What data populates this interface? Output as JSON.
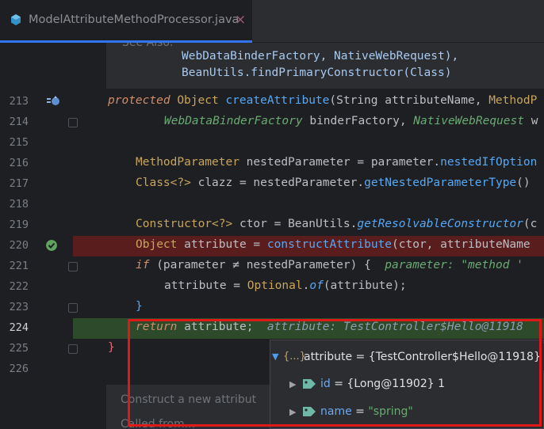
{
  "tab": {
    "filename": "ModelAttributeMethodProcessor.java",
    "close": "×"
  },
  "doc": {
    "faded_line": "See Also:",
    "line1": "WebDataBinderFactory, NativeWebRequest),",
    "line2": "BeanUtils.findPrimaryConstructor(Class)",
    "bottom1": "Construct a new attribut",
    "bottom2": "Called from..."
  },
  "lines": [
    {
      "num": "213"
    },
    {
      "num": "214"
    },
    {
      "num": "215"
    },
    {
      "num": "216"
    },
    {
      "num": "217"
    },
    {
      "num": "218"
    },
    {
      "num": "219"
    },
    {
      "num": "220"
    },
    {
      "num": "221"
    },
    {
      "num": "222"
    },
    {
      "num": "223"
    },
    {
      "num": "224"
    },
    {
      "num": "225"
    },
    {
      "num": "226"
    }
  ],
  "code": {
    "l213": {
      "kw": "protected",
      "type": "Object",
      "fn": "createAttribute",
      "rest1": "(String attributeName, ",
      "type2": "MethodP"
    },
    "l214": {
      "t1": "WebDataBinderFactory",
      "r1": " binderFactory, ",
      "t2": "NativeWebRequest",
      "r2": " w"
    },
    "l216": {
      "t1": "MethodParameter",
      "r1": " nestedParameter = parameter.",
      "fn": "nestedIfOption"
    },
    "l217": {
      "t1": "Class",
      "g": "<?>",
      "r1": " clazz = nestedParameter.",
      "fn": "getNestedParameterType",
      "r2": "()"
    },
    "l219": {
      "t1": "Constructor",
      "g": "<?>",
      "r1": " ctor = BeanUtils.",
      "fn": "getResolvableConstructor",
      "r2": "(c"
    },
    "l220": {
      "t1": "Object",
      "r1": " attribute = ",
      "fn": "constructAttribute",
      "r2": "(ctor, attributeName"
    },
    "l221": {
      "kw": "if",
      "r1": " (parameter ",
      "ne": "≠",
      "r2": " nestedParameter) {  ",
      "hint": "parameter: \"method '"
    },
    "l222": {
      "r1": "attribute = ",
      "t1": "Optional",
      "r2": ".",
      "fn": "of",
      "r3": "(attribute);"
    },
    "l223": {
      "r1": "}"
    },
    "l224": {
      "kw": "return",
      "r1": " attribute;  ",
      "hint": "attribute: TestController$Hello@11918"
    },
    "l225": {
      "r1": "}"
    }
  },
  "popup": {
    "root": {
      "icon": "{...}",
      "label": "attribute = {TestController$Hello@11918}"
    },
    "children": [
      {
        "name": "id",
        "value": " = {Long@11902} 1"
      },
      {
        "name": "name",
        "value_prefix": " = ",
        "value": "\"spring\""
      }
    ]
  },
  "colors": {
    "breakpoint_line": "#5a1d1d",
    "execution_line": "#2d4a2a",
    "highlight_box": "#e01818",
    "tab_underline": "#3574f0"
  }
}
